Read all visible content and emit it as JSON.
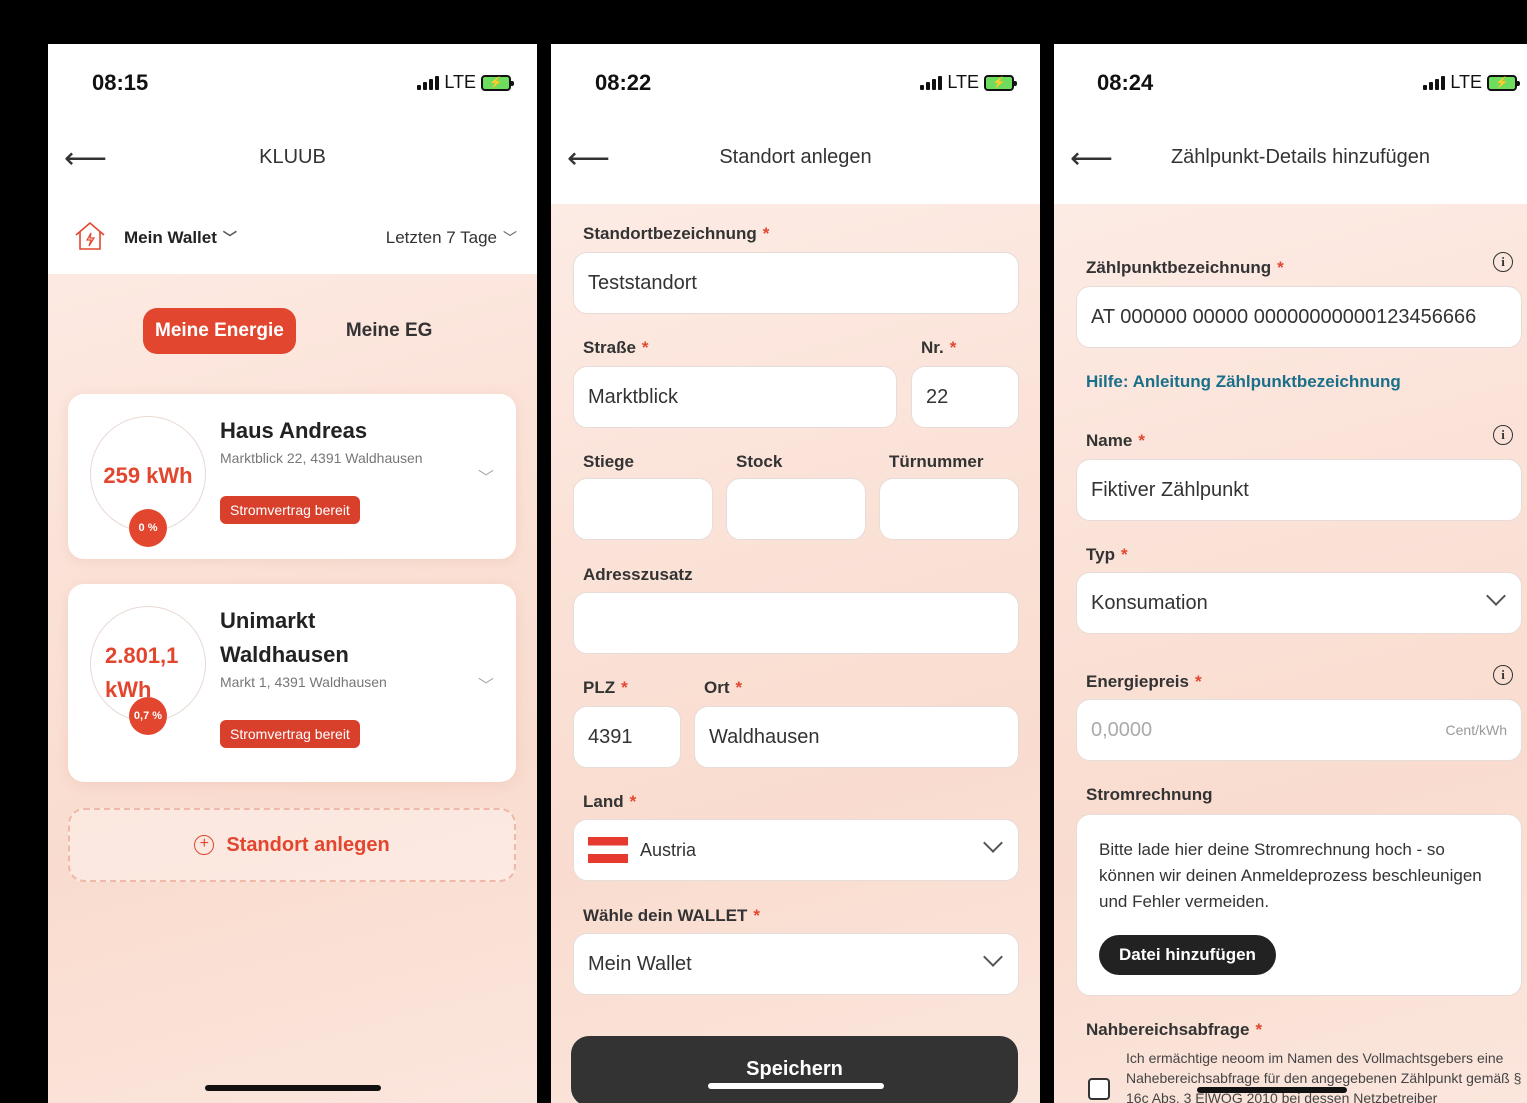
{
  "screens": [
    {
      "time": "08:15",
      "network": "LTE",
      "title": "KLUUB",
      "wallet": "Mein Wallet",
      "range": "Letzten 7 Tage",
      "tabs": [
        "Meine Energie",
        "Meine EG"
      ],
      "sites": [
        {
          "name": "Haus Andreas",
          "kwh": "259 kWh",
          "pct": "0 %",
          "address": "Marktblick 22, 4391 Waldhausen",
          "badge": "Stromvertrag bereit"
        },
        {
          "name": "Unimarkt Waldhausen",
          "kwh": "2.801,1 kWh",
          "pct": "0,7 %",
          "address": "Markt 1, 4391 Waldhausen",
          "badge": "Stromvertrag bereit"
        }
      ],
      "add_site": "Standort anlegen"
    },
    {
      "time": "08:22",
      "network": "LTE",
      "title": "Standort anlegen",
      "fields": {
        "name_label": "Standortbezeichnung",
        "name_value": "Teststandort",
        "street_label": "Straße",
        "street_value": "Marktblick",
        "nr_label": "Nr.",
        "nr_value": "22",
        "stair_label": "Stiege",
        "floor_label": "Stock",
        "door_label": "Türnummer",
        "addr_extra_label": "Adresszusatz",
        "zip_label": "PLZ",
        "zip_value": "4391",
        "city_label": "Ort",
        "city_value": "Waldhausen",
        "country_label": "Land",
        "country_value": "Austria",
        "wallet_label": "Wähle dein WALLET",
        "wallet_value": "Mein Wallet"
      },
      "save": "Speichern"
    },
    {
      "time": "08:24",
      "network": "LTE",
      "title": "Zählpunkt-Details hinzufügen",
      "fields": {
        "mp_label": "Zählpunktbezeichnung",
        "mp_value": "AT 000000 00000 00000000000123456666",
        "help": "Hilfe: Anleitung Zählpunktbezeichnung",
        "name_label": "Name",
        "name_value": "Fiktiver Zählpunkt",
        "type_label": "Typ",
        "type_value": "Konsumation",
        "price_label": "Energiepreis",
        "price_placeholder": "0,0000",
        "price_unit": "Cent/kWh",
        "bill_label": "Stromrechnung",
        "bill_text": "Bitte lade hier deine Stromrechnung hoch - so können wir deinen Anmeldeprozess beschleunigen und Fehler vermeiden.",
        "file_button": "Datei hinzufügen",
        "nb_label": "Nahbereichsabfrage",
        "nb_text": "Ich ermächtige neoom im Namen des Vollmachtsgebers eine Nahebereichsabfrage für den angegebenen Zählpunkt gemäß § 16c Abs. 3 ElWOG 2010 bei dessen Netzbetreiber"
      }
    }
  ],
  "required_mark": "*",
  "colors": {
    "accent": "#e2462e",
    "link": "#1a6f8a",
    "dark_button": "#333333"
  }
}
